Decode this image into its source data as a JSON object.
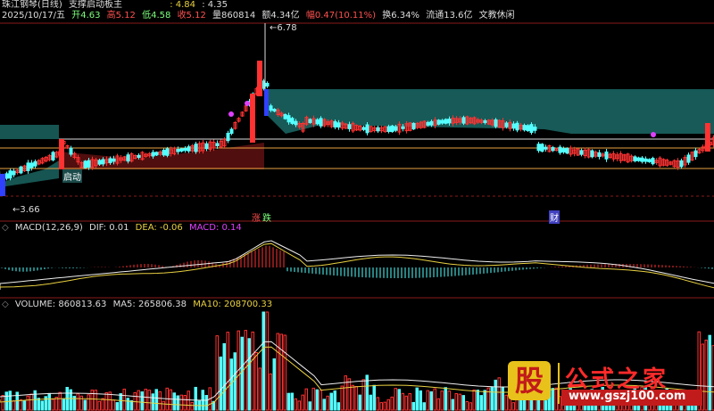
{
  "header": {
    "stock": "珠江钢琴(日线)",
    "indicator": "支撑启动板主",
    "indicator_vals": [
      ": 4.84",
      ": 4.35"
    ],
    "date": "2025/10/17/五",
    "open": "开4.63",
    "high": "高5.12",
    "low": "低4.58",
    "close": "收5.12",
    "vol": "量860814",
    "amount": "额4.34亿",
    "change": "幅0.47(10.11%)",
    "turnover": "换6.34%",
    "float": "流通13.6亿",
    "sector": "文教休闲"
  },
  "main_chart": {
    "high_label": "6.78",
    "low_label": "3.66",
    "start_label": "启动",
    "event_markers": [
      "涨",
      "跌",
      "财"
    ]
  },
  "macd_panel": {
    "title": "MACD(12,26,9)",
    "dif": "DIF: 0.01",
    "dea": "DEA: -0.06",
    "macd": "MACD: 0.14"
  },
  "volume_panel": {
    "title": "VOLUME: 860813.63",
    "ma5": "MA5: 265806.38",
    "ma10": "MA10: 208700.33"
  },
  "watermark": {
    "logo_char": "股",
    "title": "公式之家",
    "url": "www.gszj100.com"
  },
  "colors": {
    "up": "#ff3232",
    "down": "#54ffff",
    "band": "#1b6a66",
    "line_orange": "#e8a040",
    "macd_purple": "#e040ff"
  }
}
